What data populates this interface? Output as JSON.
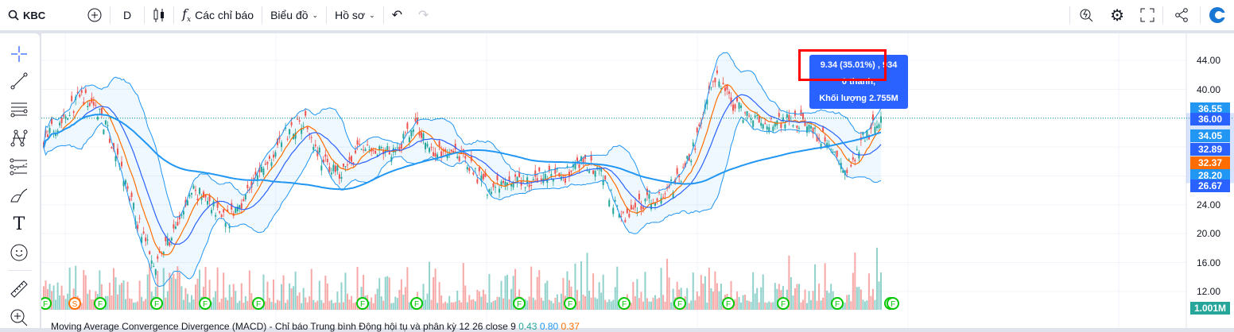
{
  "toolbar": {
    "symbol": "KBC",
    "interval": "D",
    "indicators_label": "Các chỉ báo",
    "chart_label": "Biểu đồ",
    "profile_label": "Hồ sơ"
  },
  "tooltip": {
    "line1": "9.34 (35.01%) , 934",
    "line2": "0 thanh,",
    "line3": "Khối lượng 2.755M"
  },
  "axis": {
    "ticks": [
      "44.00",
      "40.00",
      "24.00",
      "20.00",
      "16.00",
      "12.00"
    ],
    "labels": [
      {
        "text": "36.55",
        "color": "#2196f3"
      },
      {
        "text": "36.00",
        "color": "#2962ff"
      },
      {
        "text": "34.05",
        "color": "#2196f3"
      },
      {
        "text": "32.89",
        "color": "#2962ff"
      },
      {
        "text": "32.37",
        "color": "#ff6d00"
      },
      {
        "text": "28.20",
        "color": "#2196f3"
      },
      {
        "text": "26.67",
        "color": "#2962ff"
      }
    ],
    "volume_label": "1.001M"
  },
  "macd": {
    "title": "Moving Average Convergence Divergence (MACD) - Chỉ báo Trung bình Động hội tụ và phân kỳ 12 26 close 9",
    "v1": "0.43",
    "v2": "0.80",
    "v3": "0.37"
  },
  "markers": [
    "F",
    "S",
    "F",
    "F",
    "F",
    "F",
    "F",
    "F",
    "F",
    "F",
    "F",
    "F",
    "F",
    "F",
    "F",
    "F",
    "F"
  ],
  "chart_data": {
    "type": "candlestick",
    "symbol": "KBC",
    "ylim": [
      10,
      46
    ],
    "last_price": 36.0,
    "price_path": [
      33,
      36,
      39,
      37,
      30,
      22,
      16,
      20,
      26,
      24,
      22,
      26,
      30,
      34,
      36,
      30,
      28,
      32,
      31,
      32,
      35,
      31,
      32,
      29,
      26,
      27,
      27,
      28,
      28,
      30,
      28,
      22,
      24,
      25,
      27,
      32,
      42,
      38,
      36,
      35,
      36,
      35,
      33,
      28,
      33,
      36
    ],
    "colors": {
      "up": "#26a69a",
      "down": "#ef5350",
      "ma_fast": "#ff6d00",
      "ma_mid": "#2962ff",
      "ma_slow": "#2196f3",
      "bands": "#2196f3"
    }
  }
}
